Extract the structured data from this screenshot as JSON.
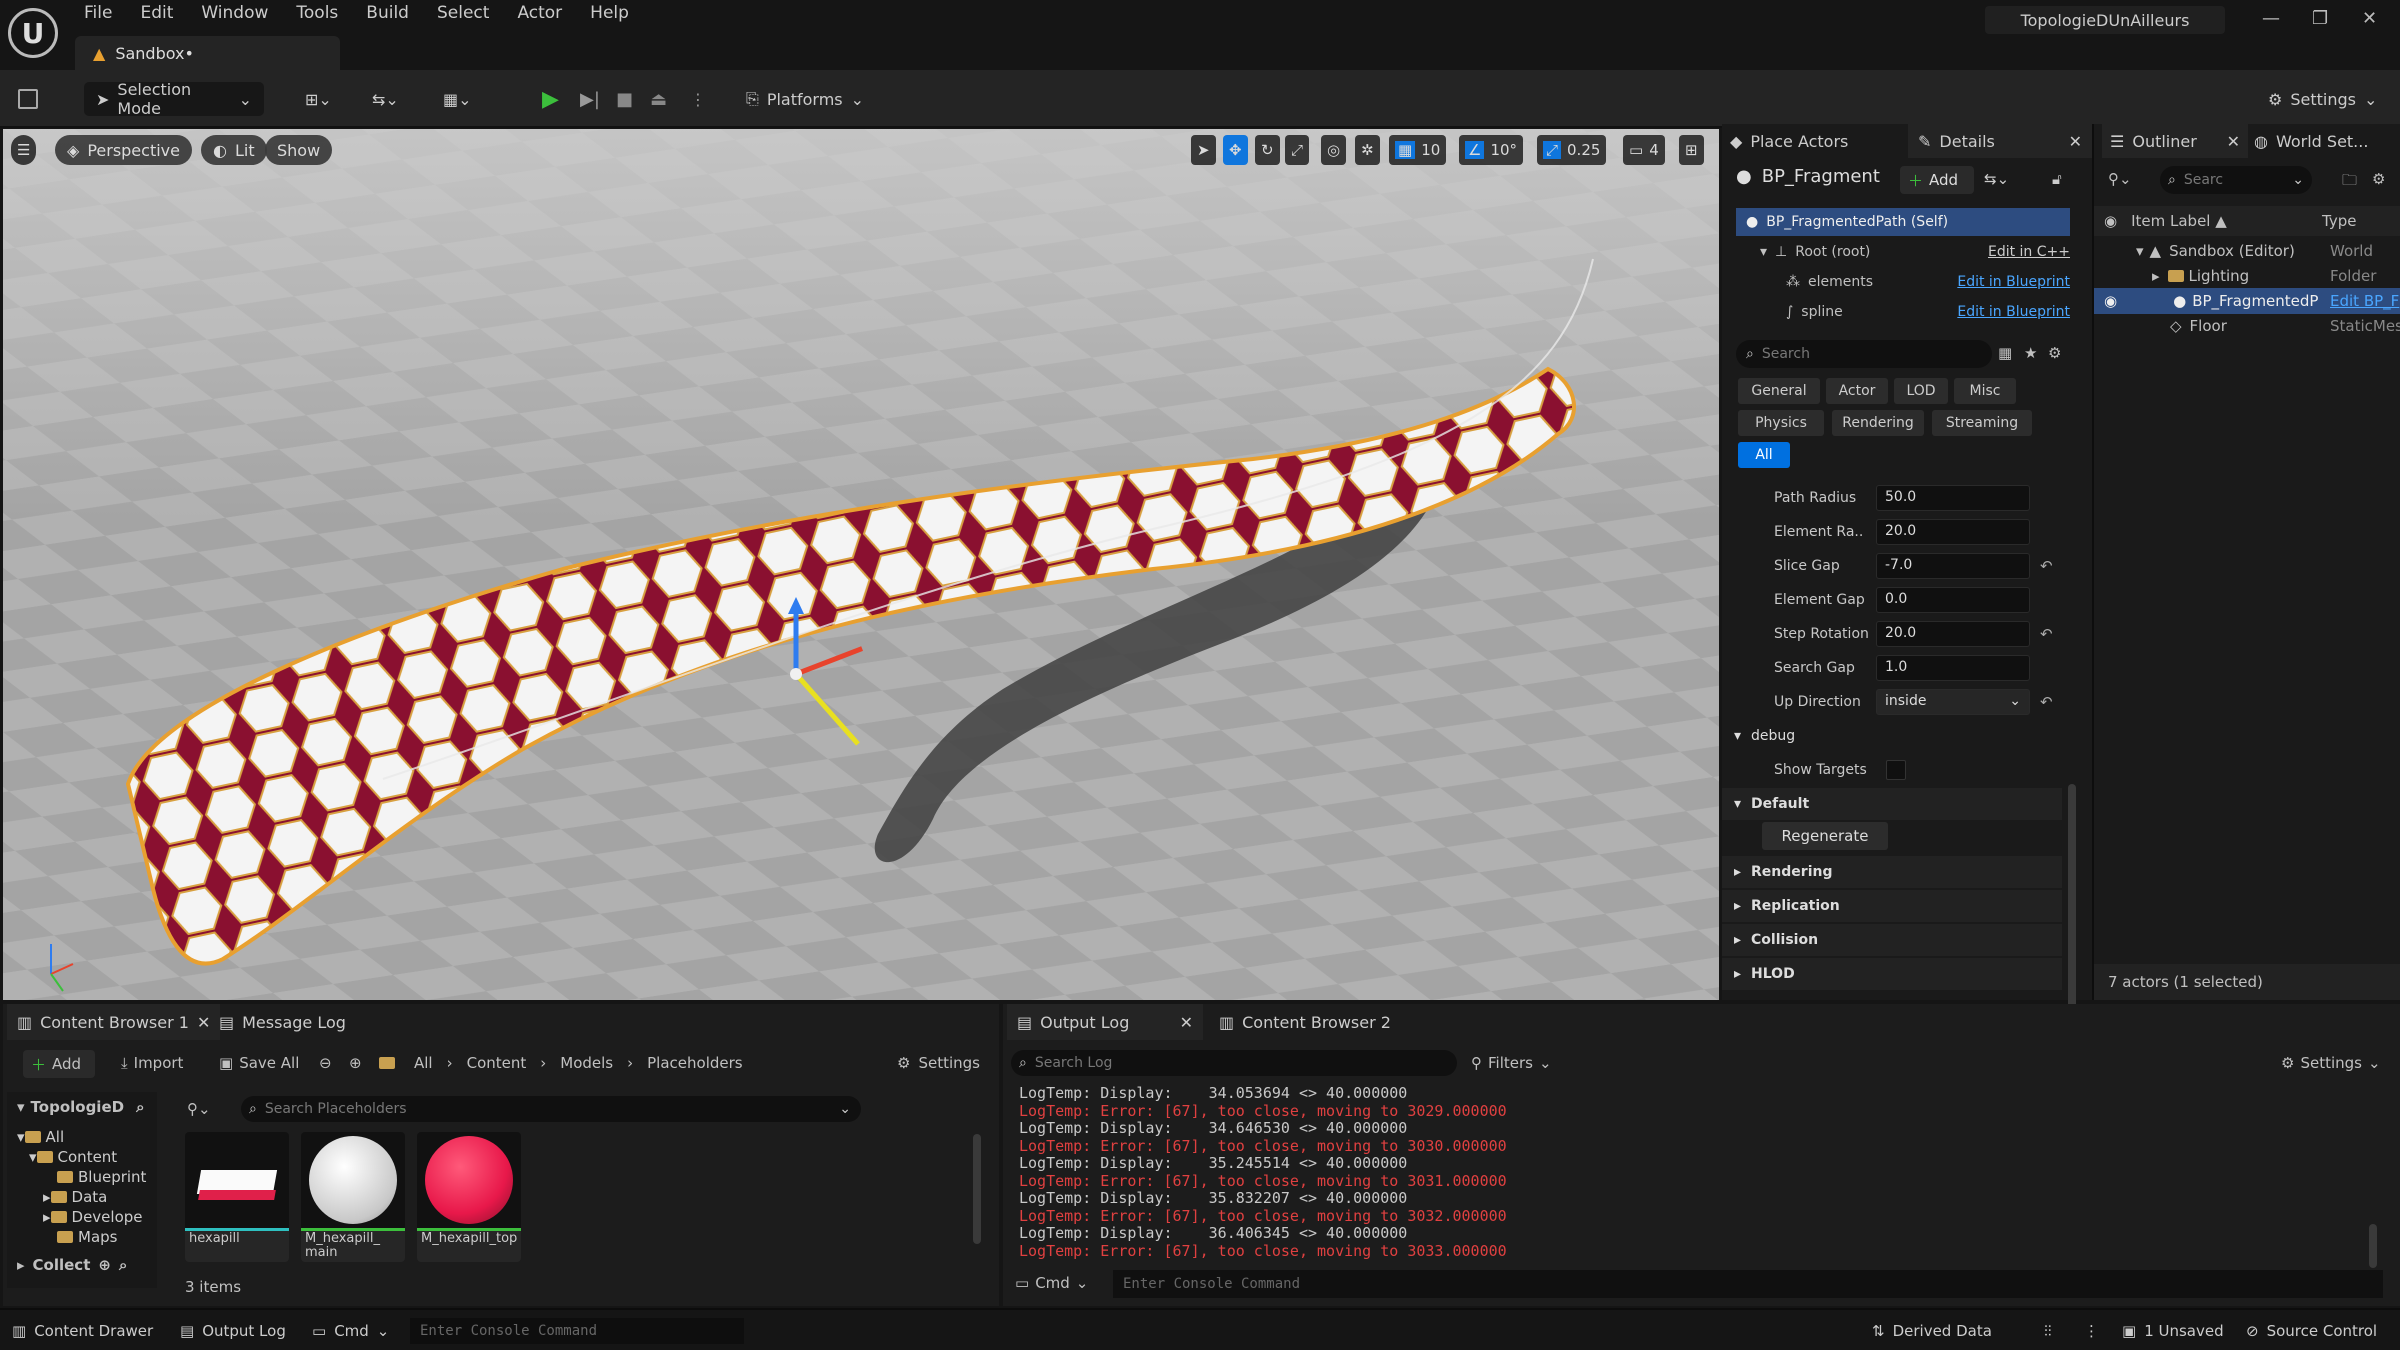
{
  "window": {
    "project_name": "TopologieDUnAilleurs",
    "doc_tab": "Sandbox•",
    "menu": [
      "File",
      "Edit",
      "Window",
      "Tools",
      "Build",
      "Select",
      "Actor",
      "Help"
    ],
    "logo_glyph": "U"
  },
  "toolbar": {
    "mode": "Selection Mode",
    "platforms": "Platforms",
    "settings": "Settings"
  },
  "viewport": {
    "perspective": "Perspective",
    "lit": "Lit",
    "show": "Show",
    "grid_snap": "10",
    "rot_snap": "10°",
    "scale_snap": "0.25",
    "cam_speed": "4"
  },
  "details": {
    "tab_place": "Place Actors",
    "tab_details": "Details",
    "actor_name": "BP_Fragment",
    "add": "Add",
    "components": [
      {
        "name": "BP_FragmentedPath (Self)",
        "link": ""
      },
      {
        "name": "Root (root)",
        "link": "Edit in C++"
      },
      {
        "name": "elements",
        "link": "Edit in Blueprint"
      },
      {
        "name": "spline",
        "link": "Edit in Blueprint"
      }
    ],
    "search_placeholder": "Search",
    "filters": [
      "General",
      "Actor",
      "LOD",
      "Misc",
      "Physics",
      "Rendering",
      "Streaming",
      "All"
    ],
    "props": [
      {
        "label": "Path Radius",
        "value": "50.0"
      },
      {
        "label": "Element Ra..",
        "value": "20.0"
      },
      {
        "label": "Slice Gap",
        "value": "-7.0"
      },
      {
        "label": "Element Gap",
        "value": "0.0"
      },
      {
        "label": "Step Rotation",
        "value": "20.0"
      },
      {
        "label": "Search Gap",
        "value": "1.0"
      },
      {
        "label": "Up Direction",
        "value": "inside"
      }
    ],
    "debug_cat": "debug",
    "show_targets": "Show Targets",
    "default_cat": "Default",
    "regenerate": "Regenerate",
    "categories": [
      "Rendering",
      "Replication",
      "Collision",
      "HLOD"
    ]
  },
  "outliner": {
    "tab": "Outliner",
    "tab_world": "World Set...",
    "search_placeholder": "Searc",
    "col_label": "Item Label ▲",
    "col_type": "Type",
    "items": [
      {
        "label": "Sandbox (Editor)",
        "type": "World"
      },
      {
        "label": "Lighting",
        "type": "Folder"
      },
      {
        "label": "BP_FragmentedP",
        "type": "Edit BP_F"
      },
      {
        "label": "Floor",
        "type": "StaticMes"
      }
    ],
    "footer": "7 actors (1 selected)"
  },
  "content_browser": {
    "tab": "Content Browser 1",
    "tab_msg": "Message Log",
    "add": "Add",
    "import": "Import",
    "save_all": "Save All",
    "crumbs": [
      "All",
      "Content",
      "Models",
      "Placeholders"
    ],
    "settings": "Settings",
    "tree_root": "TopologieD",
    "tree": [
      "All",
      "Content",
      "Blueprint",
      "Data",
      "Develope",
      "Maps"
    ],
    "collect": "Collect",
    "search_placeholder": "Search Placeholders",
    "assets": [
      {
        "name": "hexapill",
        "color": "#ffffff"
      },
      {
        "name": "M_hexapill_\nmain",
        "color": "#f0f0f0"
      },
      {
        "name": "M_hexapill_top",
        "color": "#e8184a"
      }
    ],
    "count": "3 items"
  },
  "output_log": {
    "tab": "Output Log",
    "tab_cb2": "Content Browser 2",
    "search_placeholder": "Search Log",
    "filters": "Filters",
    "settings": "Settings",
    "lines": [
      {
        "t": "LogTemp: Display:    34.053694 <> 40.000000",
        "e": false
      },
      {
        "t": "LogTemp: Error: [67], too close, moving to 3029.000000",
        "e": true
      },
      {
        "t": "LogTemp: Display:    34.646530 <> 40.000000",
        "e": false
      },
      {
        "t": "LogTemp: Error: [67], too close, moving to 3030.000000",
        "e": true
      },
      {
        "t": "LogTemp: Display:    35.245514 <> 40.000000",
        "e": false
      },
      {
        "t": "LogTemp: Error: [67], too close, moving to 3031.000000",
        "e": true
      },
      {
        "t": "LogTemp: Display:    35.832207 <> 40.000000",
        "e": false
      },
      {
        "t": "LogTemp: Error: [67], too close, moving to 3032.000000",
        "e": true
      },
      {
        "t": "LogTemp: Display:    36.406345 <> 40.000000",
        "e": false
      },
      {
        "t": "LogTemp: Error: [67], too close, moving to 3033.000000",
        "e": true
      }
    ],
    "cmd": "Cmd",
    "cmd_placeholder": "Enter Console Command"
  },
  "statusbar": {
    "content_drawer": "Content Drawer",
    "output_log": "Output Log",
    "cmd": "Cmd",
    "cmd_placeholder": "Enter Console Command",
    "derived_data": "Derived Data",
    "unsaved": "1 Unsaved",
    "source_control": "Source Control"
  },
  "colors": {
    "accent": "#0070e0",
    "log_error": "#e04040",
    "hex_red": "#b0143c",
    "outline_orange": "#e8a030"
  }
}
